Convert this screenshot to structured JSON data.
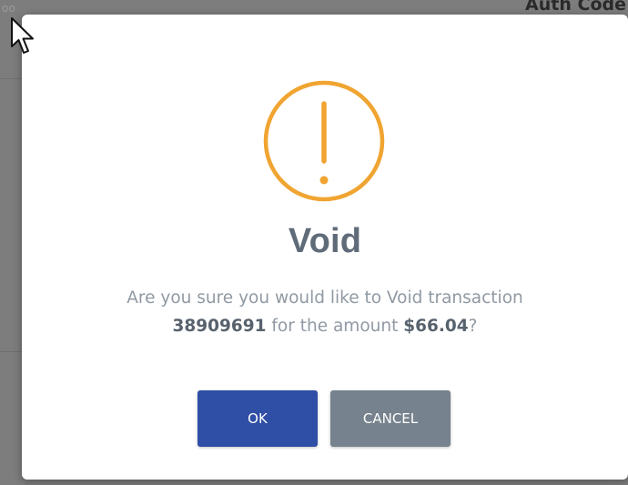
{
  "background": {
    "header_text": "Auth Code",
    "left_text": "oo"
  },
  "dialog": {
    "icon": "exclamation-circle-icon",
    "icon_color": "#f0a431",
    "title": "Void",
    "message_prefix": "Are you sure you would like to Void transaction",
    "transaction_id": "38909691",
    "message_middle": " for the amount ",
    "amount": "$66.04",
    "message_suffix": "?",
    "ok_label": "OK",
    "cancel_label": "CANCEL",
    "ok_color": "#2f4ea6",
    "cancel_color": "#76828d"
  }
}
